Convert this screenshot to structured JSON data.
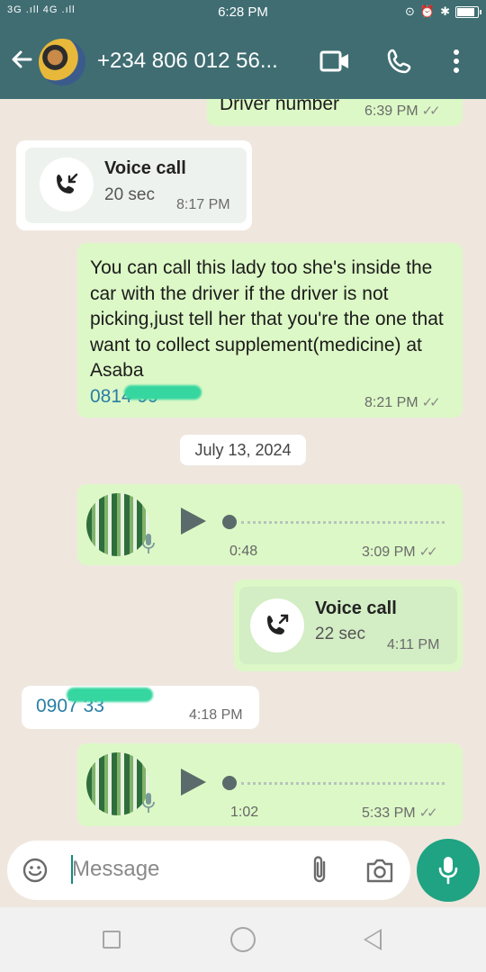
{
  "status_bar": {
    "signal": "3G .ıll 4G .ıll",
    "time": "6:28 PM",
    "battery_level": 0.8
  },
  "header": {
    "contact_name": "+234 806 012 56...",
    "back_icon": "arrow-left-icon",
    "video_icon": "video-camera-icon",
    "call_icon": "phone-icon",
    "menu_icon": "more-vertical-icon"
  },
  "messages": {
    "partial": {
      "text": "Driver number",
      "time": "6:39 PM"
    },
    "call_in": {
      "title": "Voice call",
      "duration": "20 sec",
      "time": "8:17 PM",
      "icon": "missed-call-incoming-icon"
    },
    "text_msg": {
      "text": "You can call this lady  too she's inside  the  car with the driver  if the driver  is not picking,just tell her that you're  the one that want  to collect supplement(medicine)  at Asaba",
      "phone": "0814  99",
      "time": "8:21 PM"
    },
    "date_chip": "July 13, 2024",
    "voice1": {
      "duration": "0:48",
      "time": "3:09 PM"
    },
    "call_out": {
      "title": "Voice call",
      "duration": "22 sec",
      "time": "4:11 PM",
      "icon": "outgoing-call-icon"
    },
    "in_phone": {
      "phone": "0907  33",
      "time": "4:18 PM"
    },
    "voice2": {
      "duration": "1:02",
      "time": "5:33 PM"
    }
  },
  "input": {
    "placeholder": "Message",
    "emoji_icon": "emoji-icon",
    "attach_icon": "paperclip-icon",
    "camera_icon": "camera-icon",
    "mic_icon": "microphone-icon"
  },
  "ticks": "✓✓",
  "colors": {
    "header": "#3f6d72",
    "outgoing_bubble": "#dcf8c6",
    "incoming_bubble": "#ffffff",
    "accent": "#1fa382",
    "link": "#2a7fa5"
  }
}
